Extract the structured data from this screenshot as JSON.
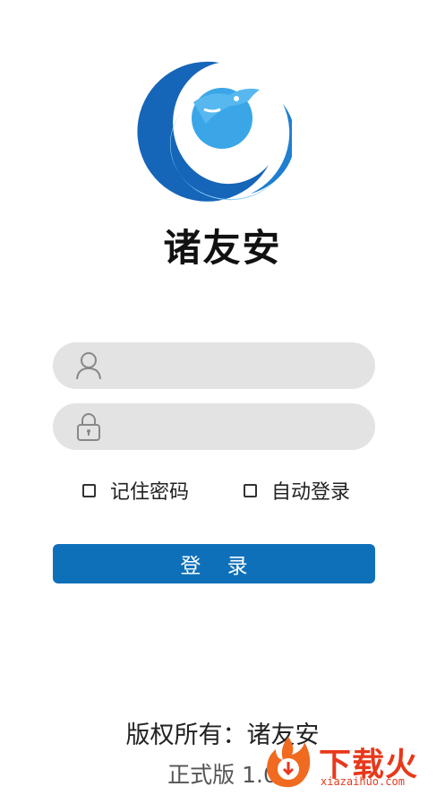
{
  "app": {
    "name": "诸友安"
  },
  "form": {
    "username_placeholder": "",
    "password_placeholder": "",
    "remember_password_label": "记住密码",
    "auto_login_label": "自动登录",
    "login_button_label": "登    录"
  },
  "footer": {
    "copyright": "版权所有：诸友安",
    "version": "正式版 1.0"
  },
  "watermark": {
    "title": "下载火",
    "subtitle": "xiazaihuo.com"
  },
  "colors": {
    "accent": "#0f70ba",
    "logo_dark": "#1565b8",
    "logo_light": "#6ec3f2",
    "field_bg": "#e3e3e3",
    "watermark": "#e8381b"
  },
  "icons": {
    "username": "user-icon",
    "password": "lock-icon"
  }
}
